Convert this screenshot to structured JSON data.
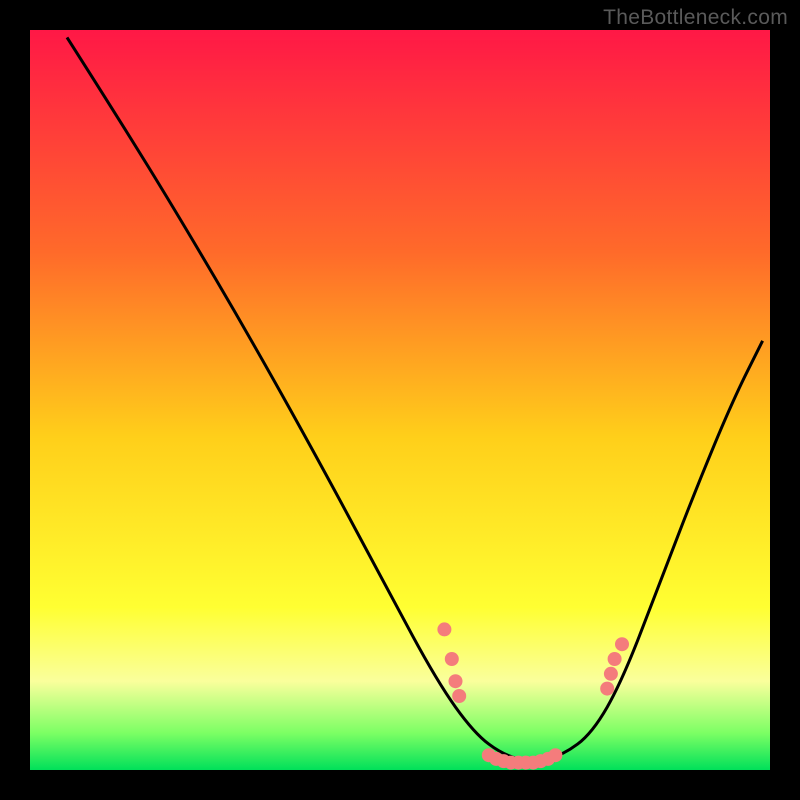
{
  "watermark": "TheBottleneck.com",
  "chart_data": {
    "type": "line",
    "title": "",
    "xlabel": "",
    "ylabel": "",
    "xlim": [
      0,
      100
    ],
    "ylim": [
      0,
      100
    ],
    "gradient_stops": [
      {
        "offset": 0,
        "color": "#ff1846"
      },
      {
        "offset": 30,
        "color": "#ff6a2a"
      },
      {
        "offset": 55,
        "color": "#ffcf1a"
      },
      {
        "offset": 78,
        "color": "#ffff32"
      },
      {
        "offset": 88,
        "color": "#faff9c"
      },
      {
        "offset": 95,
        "color": "#7cff64"
      },
      {
        "offset": 100,
        "color": "#00e05a"
      }
    ],
    "curve": [
      {
        "x": 5,
        "y": 99
      },
      {
        "x": 12,
        "y": 88
      },
      {
        "x": 20,
        "y": 75
      },
      {
        "x": 30,
        "y": 58
      },
      {
        "x": 40,
        "y": 40
      },
      {
        "x": 48,
        "y": 25
      },
      {
        "x": 55,
        "y": 12
      },
      {
        "x": 60,
        "y": 5
      },
      {
        "x": 64,
        "y": 2
      },
      {
        "x": 68,
        "y": 1
      },
      {
        "x": 72,
        "y": 2
      },
      {
        "x": 76,
        "y": 5
      },
      {
        "x": 80,
        "y": 12
      },
      {
        "x": 85,
        "y": 25
      },
      {
        "x": 90,
        "y": 38
      },
      {
        "x": 95,
        "y": 50
      },
      {
        "x": 99,
        "y": 58
      }
    ],
    "markers": [
      {
        "x": 56,
        "y": 19
      },
      {
        "x": 57,
        "y": 15
      },
      {
        "x": 57.5,
        "y": 12
      },
      {
        "x": 58,
        "y": 10
      },
      {
        "x": 62,
        "y": 2
      },
      {
        "x": 63,
        "y": 1.5
      },
      {
        "x": 64,
        "y": 1.2
      },
      {
        "x": 65,
        "y": 1
      },
      {
        "x": 66,
        "y": 1
      },
      {
        "x": 67,
        "y": 1
      },
      {
        "x": 68,
        "y": 1
      },
      {
        "x": 69,
        "y": 1.2
      },
      {
        "x": 70,
        "y": 1.5
      },
      {
        "x": 71,
        "y": 2
      },
      {
        "x": 78,
        "y": 11
      },
      {
        "x": 78.5,
        "y": 13
      },
      {
        "x": 79,
        "y": 15
      },
      {
        "x": 80,
        "y": 17
      }
    ],
    "marker_color": "#f47c7c",
    "curve_color": "#000000"
  }
}
